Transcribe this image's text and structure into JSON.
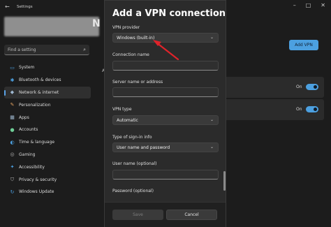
{
  "window": {
    "app_title": "Settings",
    "controls": {
      "minimize": "–",
      "maximize": "□",
      "close": "✕"
    }
  },
  "search": {
    "placeholder": "Find a setting"
  },
  "sidebar": {
    "items": [
      {
        "label": "System",
        "icon": "monitor-icon",
        "glyph": "▭",
        "color": "#4ca0e0"
      },
      {
        "label": "Bluetooth & devices",
        "icon": "bluetooth-icon",
        "glyph": "✱",
        "color": "#4ca0e0"
      },
      {
        "label": "Network & internet",
        "icon": "wifi-icon",
        "glyph": "◆",
        "color": "#9fb8d0",
        "active": true
      },
      {
        "label": "Personalization",
        "icon": "brush-icon",
        "glyph": "✎",
        "color": "#e0a060"
      },
      {
        "label": "Apps",
        "icon": "apps-icon",
        "glyph": "▦",
        "color": "#9fb8d0"
      },
      {
        "label": "Accounts",
        "icon": "person-icon",
        "glyph": "●",
        "color": "#6fcf97"
      },
      {
        "label": "Time & language",
        "icon": "globe-icon",
        "glyph": "◐",
        "color": "#4ca0e0"
      },
      {
        "label": "Gaming",
        "icon": "gamepad-icon",
        "glyph": "◎",
        "color": "#b0b0b0"
      },
      {
        "label": "Accessibility",
        "icon": "accessibility-icon",
        "glyph": "✦",
        "color": "#4ca0e0"
      },
      {
        "label": "Privacy & security",
        "icon": "shield-icon",
        "glyph": "⛉",
        "color": "#b0b0b0"
      },
      {
        "label": "Windows Update",
        "icon": "update-icon",
        "glyph": "↻",
        "color": "#4ca0e0"
      }
    ]
  },
  "background": {
    "heading_fragment": "N",
    "side_mark": "A",
    "add_vpn_label": "Add VPN",
    "toggle_rows": [
      {
        "label": "On"
      },
      {
        "label": "On"
      }
    ]
  },
  "dialog": {
    "title": "Add a VPN connection",
    "fields": {
      "vpn_provider": {
        "label": "VPN provider",
        "value": "Windows (built-in)"
      },
      "connection_name": {
        "label": "Connection name",
        "value": ""
      },
      "server": {
        "label": "Server name or address",
        "value": ""
      },
      "vpn_type": {
        "label": "VPN type",
        "value": "Automatic"
      },
      "signin_type": {
        "label": "Type of sign-in info",
        "value": "User name and password"
      },
      "username": {
        "label": "User name (optional)",
        "value": ""
      },
      "password": {
        "label": "Password (optional)"
      }
    },
    "buttons": {
      "save": "Save",
      "cancel": "Cancel"
    }
  },
  "annotation": {
    "color": "#e0232a"
  }
}
